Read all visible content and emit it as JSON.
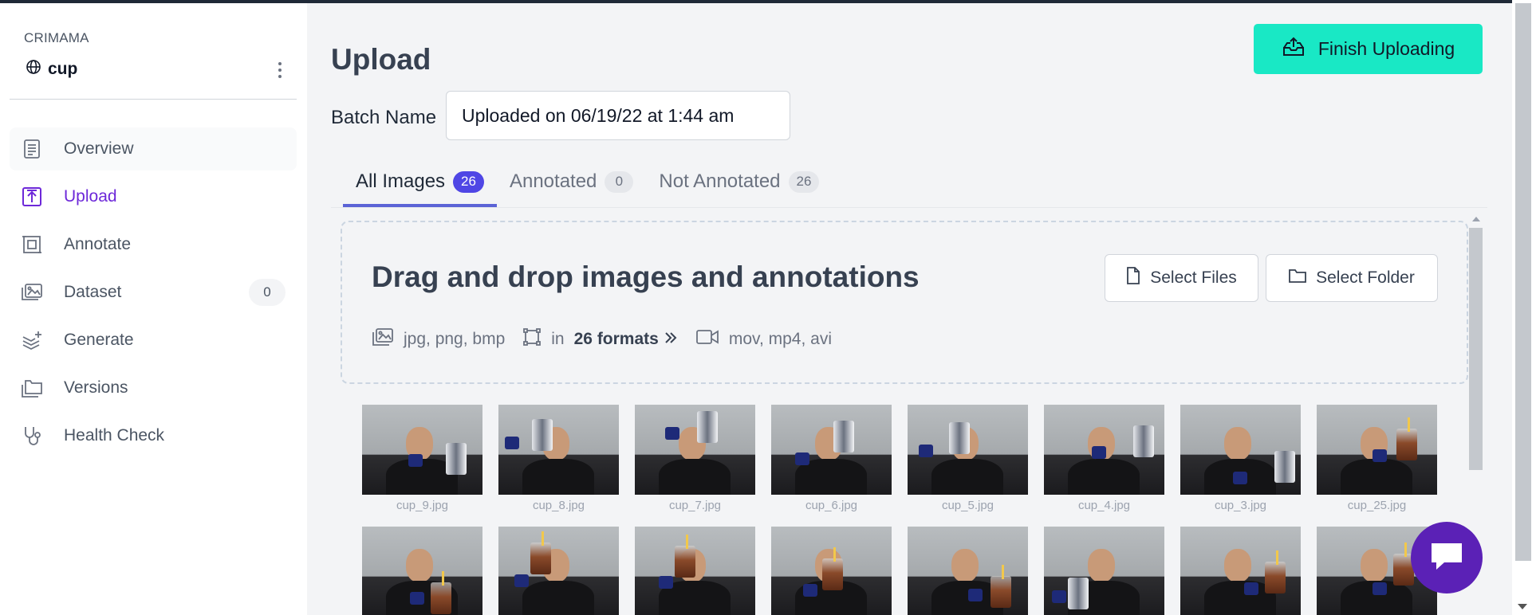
{
  "sidebar": {
    "workspace": "CRIMAMA",
    "project": "cup",
    "items": [
      {
        "label": "Overview",
        "icon": "book-icon"
      },
      {
        "label": "Upload",
        "icon": "upload-icon"
      },
      {
        "label": "Annotate",
        "icon": "annotate-icon"
      },
      {
        "label": "Dataset",
        "icon": "images-icon",
        "badge": "0"
      },
      {
        "label": "Generate",
        "icon": "generate-icon"
      },
      {
        "label": "Versions",
        "icon": "folders-icon"
      },
      {
        "label": "Health Check",
        "icon": "stethoscope-icon"
      }
    ],
    "active": "Upload"
  },
  "main": {
    "title": "Upload",
    "finish_button": "Finish Uploading",
    "batch_label": "Batch Name",
    "batch_value": "Uploaded on 06/19/22 at 1:44 am",
    "tabs": [
      {
        "label": "All Images",
        "count": "26"
      },
      {
        "label": "Annotated",
        "count": "0"
      },
      {
        "label": "Not Annotated",
        "count": "26"
      }
    ],
    "dropzone": {
      "title": "Drag and drop images and annotations",
      "select_files": "Select Files",
      "select_folder": "Select Folder",
      "image_formats": "jpg, png, bmp",
      "annotation_formats_prefix": "in",
      "annotation_formats": "26 formats",
      "video_formats": "mov, mp4, avi"
    },
    "images": [
      {
        "name": "cup_9.jpg"
      },
      {
        "name": "cup_8.jpg"
      },
      {
        "name": "cup_7.jpg"
      },
      {
        "name": "cup_6.jpg"
      },
      {
        "name": "cup_5.jpg"
      },
      {
        "name": "cup_4.jpg"
      },
      {
        "name": "cup_3.jpg"
      },
      {
        "name": "cup_25.jpg"
      },
      {
        "name": ""
      },
      {
        "name": ""
      },
      {
        "name": ""
      },
      {
        "name": ""
      },
      {
        "name": ""
      },
      {
        "name": ""
      },
      {
        "name": ""
      },
      {
        "name": ""
      }
    ]
  },
  "colors": {
    "accent": "#19e8c5",
    "active_nav": "#6d28d9",
    "tab_badge": "#4f46e5",
    "chat": "#5b21b6"
  }
}
